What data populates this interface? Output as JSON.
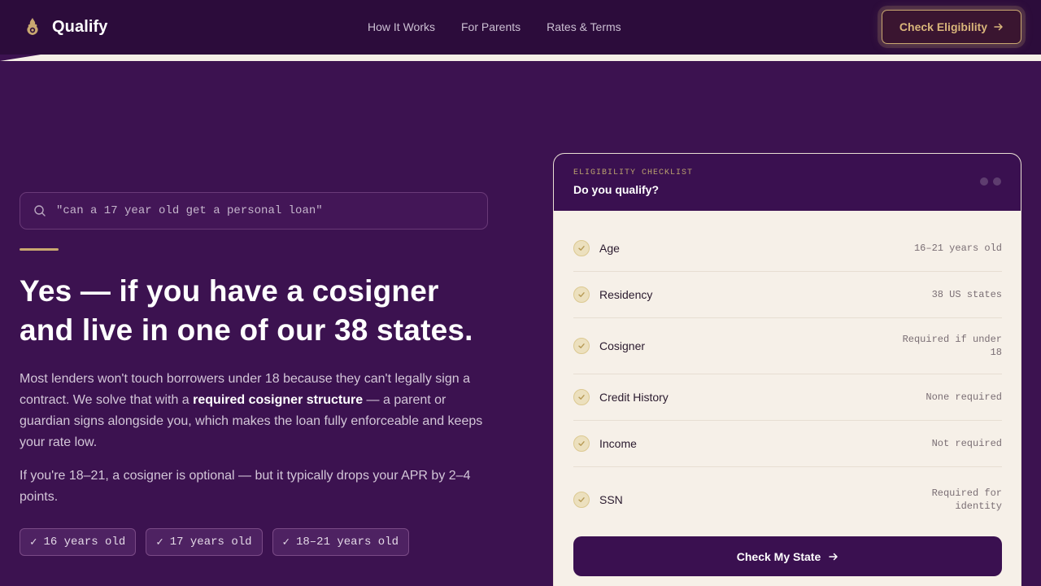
{
  "nav": {
    "brand": "Qualify",
    "links": [
      "How It Works",
      "For Parents",
      "Rates & Terms"
    ],
    "cta_label": "Check Eligibility"
  },
  "hero": {
    "search_query": "\"can a 17 year old get a personal loan\"",
    "headline_line1": "Yes — if you have a cosigner",
    "headline_line2": "and live in one of our 38 states.",
    "para1_before": "Most lenders won't touch borrowers under 18 because they can't legally sign a contract. We solve that with a ",
    "para1_bold": "required cosigner structure",
    "para1_after": " — a parent or guardian signs alongside you, which makes the loan fully enforceable and keeps your rate low.",
    "para2": "If you're 18–21, a cosigner is optional — but it typically drops your APR by 2–4 points.",
    "chips": [
      "16 years old",
      "17 years old",
      "18–21 years old"
    ]
  },
  "checklist": {
    "eyebrow": "ELIGIBILITY CHECKLIST",
    "title": "Do you qualify?",
    "rows": [
      {
        "label": "Age",
        "value": "16–21 years old"
      },
      {
        "label": "Residency",
        "value": "38 US states"
      },
      {
        "label": "Cosigner",
        "value": "Required if under 18"
      },
      {
        "label": "Credit History",
        "value": "None required"
      },
      {
        "label": "Income",
        "value": "Not required"
      },
      {
        "label": "SSN",
        "value": "Required for identity"
      }
    ],
    "button_label": "Check My State"
  },
  "colors": {
    "background": "#3c1250",
    "accent_gold": "#c9a870",
    "card_bg": "#f6f0e8"
  },
  "icons": {
    "logo": "flame-badge-icon",
    "search": "search-icon",
    "arrow": "arrow-right-icon",
    "check": "check-icon"
  }
}
